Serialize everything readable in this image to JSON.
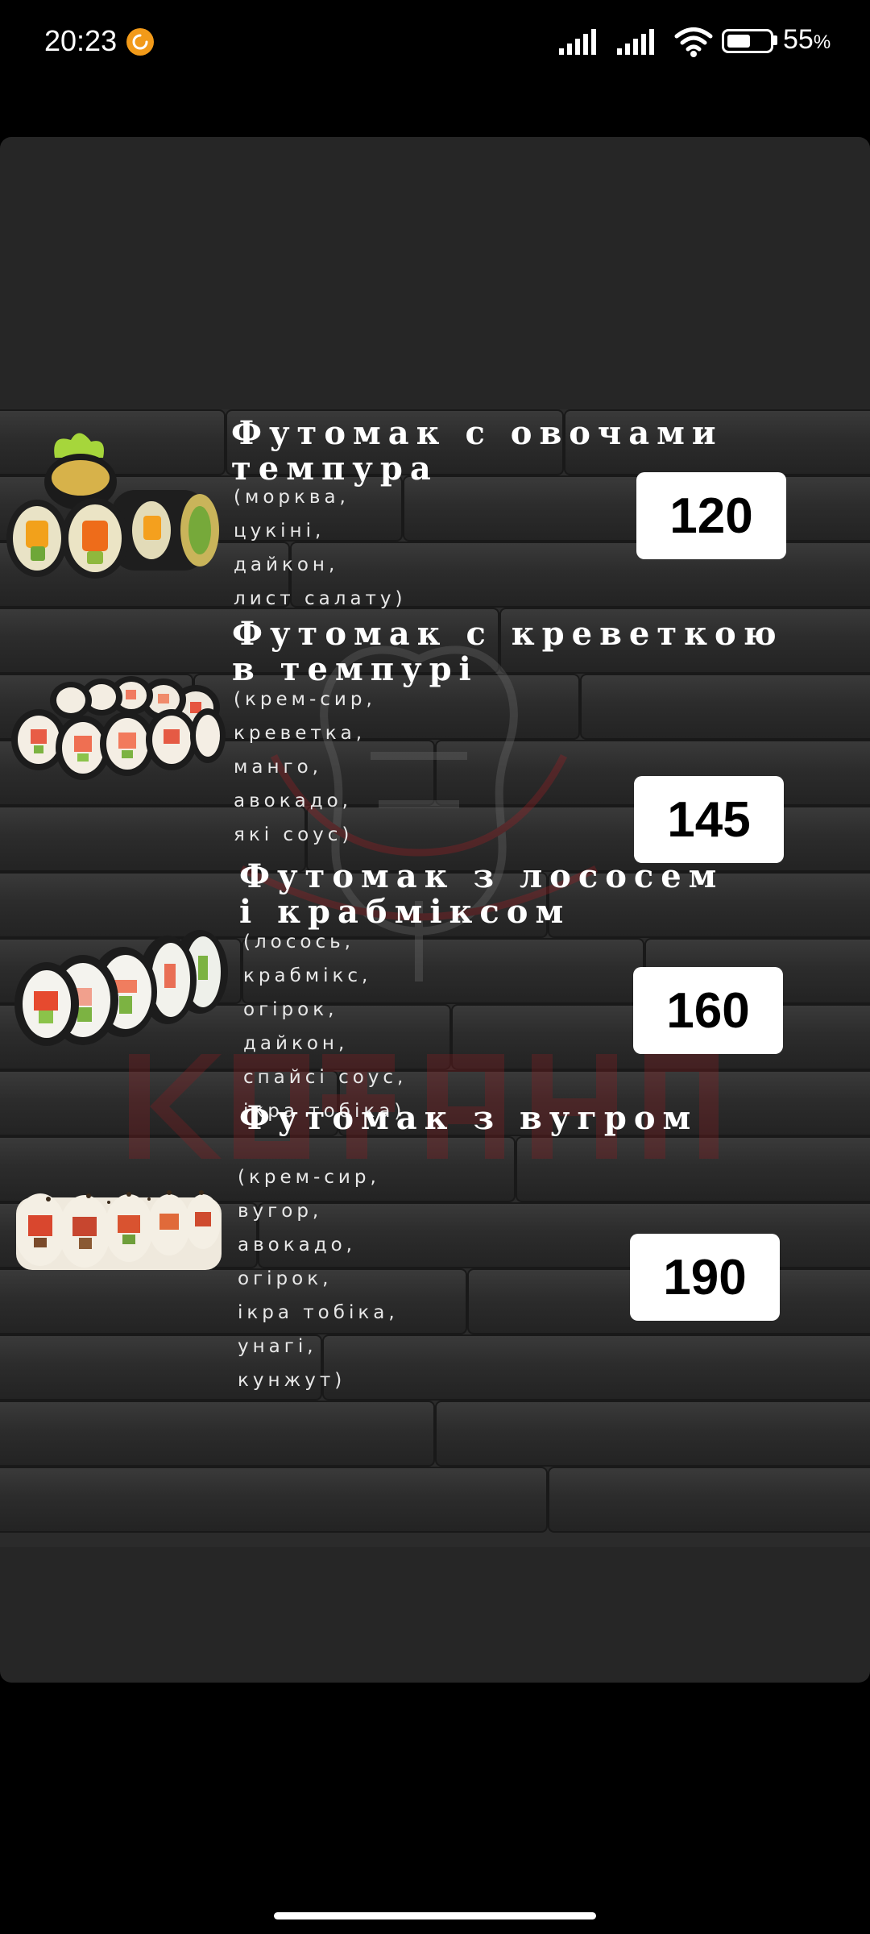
{
  "status_bar": {
    "time": "20:23",
    "battery_percent": "55",
    "battery_unit": "%",
    "icons": [
      "notification-icon",
      "signal-icon",
      "signal-icon",
      "wifi-icon",
      "battery-icon"
    ]
  },
  "menu": {
    "items": [
      {
        "title": "Футомак с овочами\nтемпура",
        "description": [
          "(морква,",
          "цукіні,",
          "дайкон,",
          "лист салату)"
        ],
        "price": "120",
        "image": "sushi-roll-image"
      },
      {
        "title": "Футомак с креветкою\nв темпурі",
        "description": [
          "(крем-сир,",
          "креветка,",
          "манго,",
          "авокадо,",
          "які соус)"
        ],
        "price": "145",
        "image": "sushi-roll-image"
      },
      {
        "title": "Футомак з лососем\nі крабміксом",
        "description": [
          "(лосось,",
          "крабмікс,",
          "огірок,",
          "дайкон,",
          "спайсі соус,",
          "ікра тобіка)"
        ],
        "price": "160",
        "image": "sushi-roll-image"
      },
      {
        "title": "Футомак з вугром",
        "description": [
          "(крем-сир,",
          "вугор,",
          "авокадо,",
          "огірок,",
          "ікра тобіка,",
          "унагі,",
          "кунжут)"
        ],
        "price": "190",
        "image": "sushi-roll-image"
      }
    ]
  },
  "colors": {
    "background": "#000000",
    "viewer": "#262626",
    "wood": "#2f2f2f",
    "price_box": "#ffffff",
    "notification": "#f29a19",
    "watermark": "#b3262b"
  }
}
